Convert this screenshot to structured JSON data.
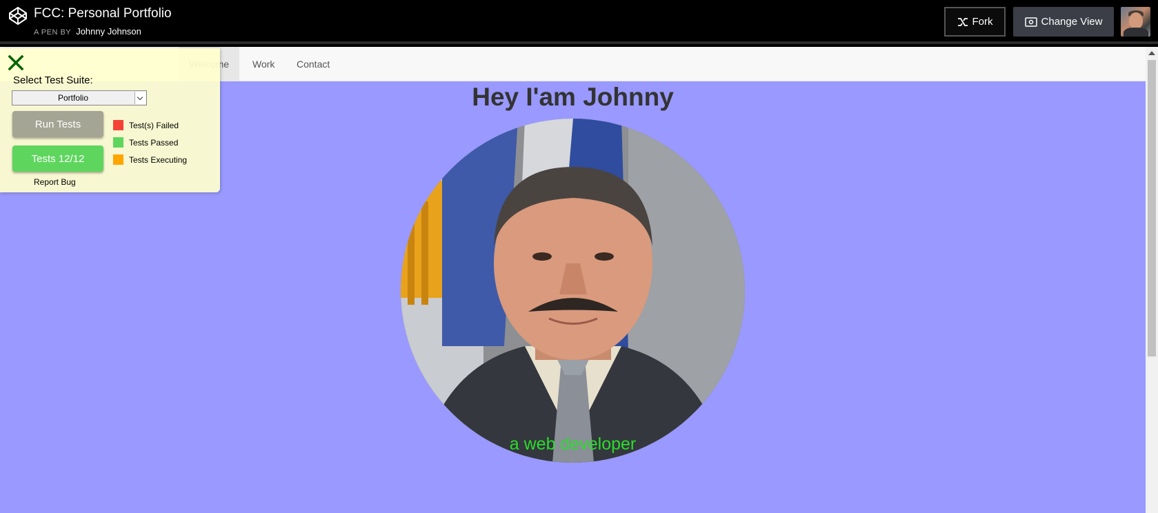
{
  "header": {
    "title": "FCC: Personal Portfolio",
    "byline_prefix": "A PEN BY",
    "author": "Johnny Johnson",
    "fork_label": "Fork",
    "change_view_label": "Change View",
    "logo_icon": "codepen-logo-icon",
    "fork_icon": "fork-icon",
    "change_view_icon": "eye-icon"
  },
  "nav": {
    "items": [
      {
        "label": "Welcome",
        "active": true
      },
      {
        "label": "Work",
        "active": false
      },
      {
        "label": "Contact",
        "active": false
      }
    ],
    "background": "#f8f8f8"
  },
  "main": {
    "heading": "Hey I'am Johnny",
    "tagline": "a web developer",
    "background": "#9999ff",
    "tagline_color": "#2bdc2b"
  },
  "fcc_panel": {
    "select_label": "Select Test Suite:",
    "selected_suite": "Portfolio",
    "run_tests_label": "Run Tests",
    "tests_result_label": "Tests 12/12",
    "report_bug_label": "Report Bug",
    "legend": [
      {
        "label": "Test(s) Failed",
        "color": "#f44336"
      },
      {
        "label": "Tests Passed",
        "color": "#5ed65e"
      },
      {
        "label": "Tests Executing",
        "color": "#ffa500"
      }
    ]
  }
}
